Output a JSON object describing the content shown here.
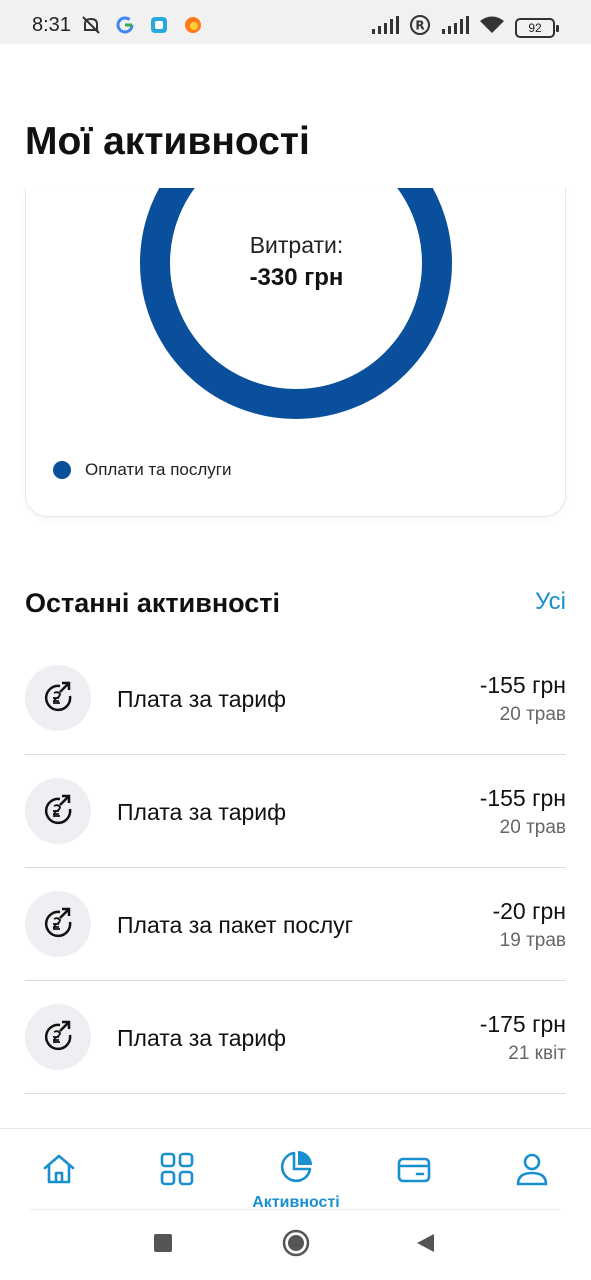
{
  "status_bar": {
    "time": "8:31",
    "battery": "92",
    "icons_left": [
      "mute-icon",
      "google-icon",
      "app-icon",
      "firefox-icon"
    ],
    "icons_right": [
      "signal-icon",
      "roaming-icon",
      "signal-icon",
      "wifi-icon",
      "battery-icon"
    ]
  },
  "page": {
    "title": "Мої активності"
  },
  "chart": {
    "center_label": "Витрати:",
    "center_value": "-330 грн",
    "segments": [
      {
        "name": "Оплати та послуги",
        "share": 1.0,
        "color": "#0a4f9c"
      }
    ],
    "legend": [
      {
        "label": "Оплати та послуги",
        "color": "#0a4f9c"
      }
    ]
  },
  "recent": {
    "title": "Останні активності",
    "see_all": "Усі",
    "items": [
      {
        "title": "Плата за тариф",
        "amount": "-155 грн",
        "date": "20 трав",
        "icon": "payment-icon"
      },
      {
        "title": "Плата за тариф",
        "amount": "-155 грн",
        "date": "20 трав",
        "icon": "payment-icon"
      },
      {
        "title": "Плата за пакет послуг",
        "amount": "-20 грн",
        "date": "19 трав",
        "icon": "payment-icon"
      },
      {
        "title": "Плата за тариф",
        "amount": "-175 грн",
        "date": "21 квіт",
        "icon": "payment-icon"
      }
    ]
  },
  "bottom_nav": {
    "items": [
      {
        "id": "home",
        "icon": "home-icon",
        "label": ""
      },
      {
        "id": "services",
        "icon": "grid-icon",
        "label": ""
      },
      {
        "id": "activities",
        "icon": "pie-chart-icon",
        "label": "Активності",
        "active": true
      },
      {
        "id": "payments",
        "icon": "card-icon",
        "label": ""
      },
      {
        "id": "profile",
        "icon": "user-icon",
        "label": ""
      }
    ]
  },
  "colors": {
    "accent": "#1a8fd0",
    "chart": "#0a4f9c"
  }
}
